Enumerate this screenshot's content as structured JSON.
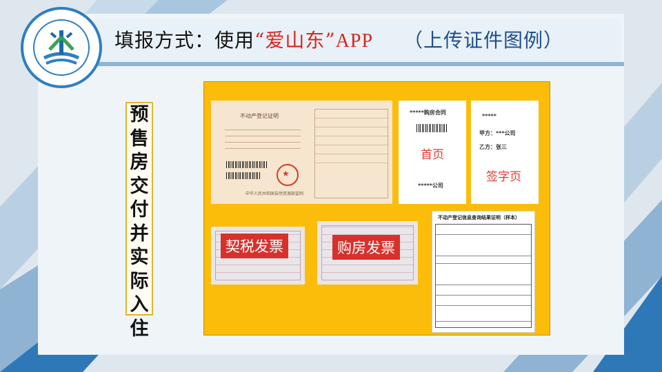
{
  "header": {
    "title_prefix": "填报方式：使用",
    "title_highlight": "“爱山东”",
    "title_app": "APP",
    "title_suffix": "（上传证件图例）"
  },
  "vertical_label": [
    "预",
    "售",
    "房",
    "交",
    "付",
    "并",
    "实",
    "际",
    "入",
    "住"
  ],
  "documents": {
    "certificate": {
      "title": "不动产登记证明",
      "footer": "中华人民共和国自然资源部监制"
    },
    "contract": {
      "header": "*****购房合同",
      "label": "首页",
      "footer": "*****公司"
    },
    "signature_page": {
      "header": "*****",
      "party_a": "甲方：***公司",
      "party_b": "乙方：张三",
      "label": "签字页"
    },
    "deed_tax_invoice": {
      "label": "契税发票"
    },
    "purchase_invoice": {
      "label": "购房发票"
    },
    "query_result": {
      "title": "不动产登记信息查询结果证明（样本）"
    }
  },
  "colors": {
    "board": "#fbbd09",
    "accent_red": "#d8312c",
    "title_red": "#d8251d",
    "frame_blue": "#2e7fc1"
  }
}
